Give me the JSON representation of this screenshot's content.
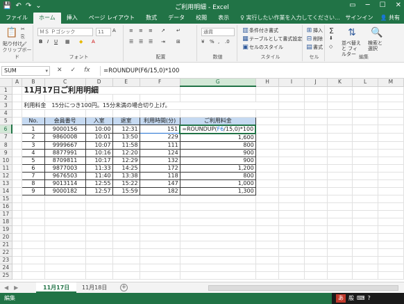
{
  "window": {
    "title": "ご利用明細 - Excel",
    "quick_access": [
      "💾",
      "↶",
      "↷",
      "⌄"
    ],
    "controls": [
      "▭",
      "─",
      "☐",
      "✕"
    ]
  },
  "ribbon_tabs": [
    "ファイル",
    "ホーム",
    "挿入",
    "ページ レイアウト",
    "数式",
    "データ",
    "校閲",
    "表示"
  ],
  "active_tab": "ホーム",
  "tell_me": "♀ 実行したい作業を入力してください...",
  "signin": "サインイン",
  "share": "共有",
  "ribbon": {
    "clipboard": {
      "paste_label": "貼り付け",
      "group_label": "クリップボード"
    },
    "font": {
      "name": "ＭＳ Ｐゴシック",
      "size": "11",
      "group_label": "フォント"
    },
    "alignment": {
      "group_label": "配置"
    },
    "number": {
      "format": "通貨",
      "group_label": "数値"
    },
    "styles": {
      "conditional": "条件付き書式",
      "table": "テーブルとして書式設定",
      "cell_styles": "セルのスタイル",
      "group_label": "スタイル"
    },
    "cells": {
      "insert": "挿入",
      "delete": "削除",
      "format": "書式",
      "group_label": "セル"
    },
    "editing": {
      "sort": "並べ替えと フィルター",
      "find": "検索と 選択",
      "group_label": "編集"
    }
  },
  "formula_bar": {
    "name_box": "SUM",
    "formula": "=ROUNDUP(F6/15,0)*100"
  },
  "grid": {
    "columns": [
      "A",
      "B",
      "C",
      "D",
      "E",
      "F",
      "G",
      "H",
      "I",
      "J",
      "K",
      "L",
      "M"
    ],
    "rows": [
      "1",
      "2",
      "3",
      "4",
      "5",
      "6",
      "7",
      "8",
      "9",
      "10",
      "11",
      "12",
      "13",
      "14",
      "15",
      "16",
      "17",
      "18",
      "19",
      "20",
      "21",
      "22",
      "23",
      "24",
      "25"
    ],
    "title": "11月17日ご利用明細",
    "note": "利用料金　15分につき100円。15分未満の場合切り上げ。",
    "headers": [
      "No.",
      "会員番号",
      "入室",
      "退室",
      "利用時間(分)",
      "ご利用料金"
    ],
    "data": [
      [
        "1",
        "9000156",
        "10:00",
        "12:31",
        "151",
        ""
      ],
      [
        "2",
        "9860008",
        "10:01",
        "13:50",
        "229",
        "1,600"
      ],
      [
        "3",
        "9999667",
        "10:07",
        "11:58",
        "111",
        "800"
      ],
      [
        "4",
        "8877991",
        "10:16",
        "12:20",
        "124",
        "900"
      ],
      [
        "5",
        "8709811",
        "10:17",
        "12:29",
        "132",
        "900"
      ],
      [
        "6",
        "9877003",
        "11:33",
        "14:25",
        "172",
        "1,200"
      ],
      [
        "7",
        "9676503",
        "11:40",
        "13:38",
        "118",
        "800"
      ],
      [
        "8",
        "9013114",
        "12:55",
        "15:22",
        "147",
        "1,000"
      ],
      [
        "9",
        "9000182",
        "12:57",
        "15:59",
        "182",
        "1,300"
      ]
    ],
    "editing_cell": {
      "before": "=ROUNDUP(",
      "ref": "F6",
      "after": "/15,0)*100"
    }
  },
  "sheet_tabs": [
    "11月17日",
    "11月18日"
  ],
  "active_sheet": "11月17日",
  "status": "編集",
  "tray": {
    "ime": "あ",
    "ime_mode": "般"
  }
}
